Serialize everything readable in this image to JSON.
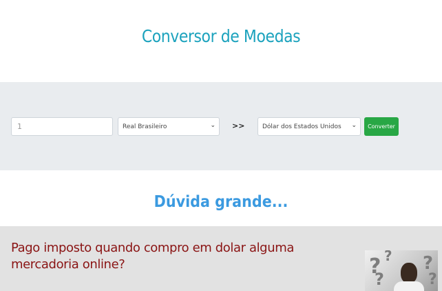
{
  "header": {
    "title": "Conversor de Moedas"
  },
  "converter": {
    "amount_value": "1",
    "from_currency": "Real Brasileiro",
    "arrow": ">>",
    "to_currency": "Dólar dos Estados Unidos",
    "convert_label": "Converter"
  },
  "doubt": {
    "heading": "Dúvida grande...",
    "question": "Pago imposto quando compro em dolar alguma mercadoria online?"
  },
  "colors": {
    "title": "#1ba2bd",
    "panel_bg": "#e9ecef",
    "button": "#28a745",
    "heading": "#3b9ae0",
    "question": "#8a1414"
  }
}
